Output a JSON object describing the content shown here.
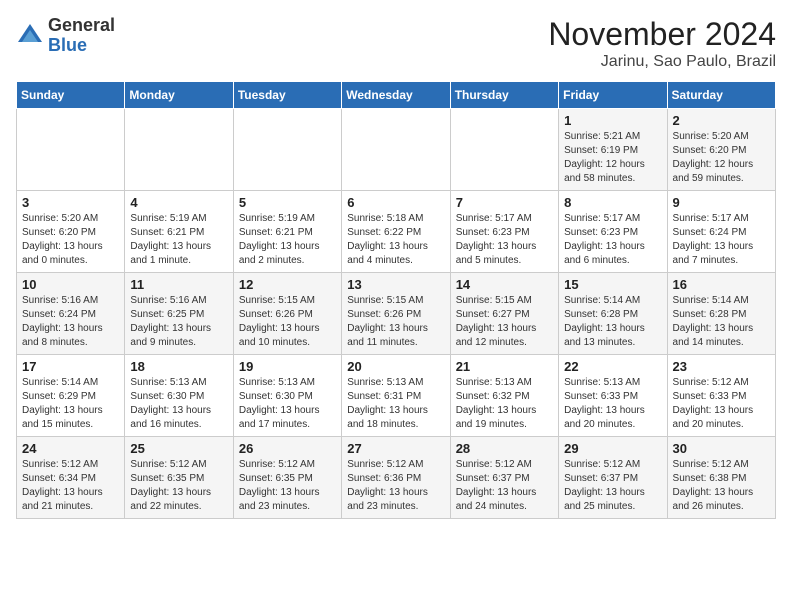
{
  "logo": {
    "general": "General",
    "blue": "Blue"
  },
  "title": "November 2024",
  "subtitle": "Jarinu, Sao Paulo, Brazil",
  "days_of_week": [
    "Sunday",
    "Monday",
    "Tuesday",
    "Wednesday",
    "Thursday",
    "Friday",
    "Saturday"
  ],
  "weeks": [
    [
      {
        "day": "",
        "sunrise": "",
        "sunset": "",
        "daylight": "",
        "empty": true
      },
      {
        "day": "",
        "sunrise": "",
        "sunset": "",
        "daylight": "",
        "empty": true
      },
      {
        "day": "",
        "sunrise": "",
        "sunset": "",
        "daylight": "",
        "empty": true
      },
      {
        "day": "",
        "sunrise": "",
        "sunset": "",
        "daylight": "",
        "empty": true
      },
      {
        "day": "",
        "sunrise": "",
        "sunset": "",
        "daylight": "",
        "empty": true
      },
      {
        "day": "1",
        "sunrise": "Sunrise: 5:21 AM",
        "sunset": "Sunset: 6:19 PM",
        "daylight": "Daylight: 12 hours and 58 minutes.",
        "empty": false
      },
      {
        "day": "2",
        "sunrise": "Sunrise: 5:20 AM",
        "sunset": "Sunset: 6:20 PM",
        "daylight": "Daylight: 12 hours and 59 minutes.",
        "empty": false
      }
    ],
    [
      {
        "day": "3",
        "sunrise": "Sunrise: 5:20 AM",
        "sunset": "Sunset: 6:20 PM",
        "daylight": "Daylight: 13 hours and 0 minutes.",
        "empty": false
      },
      {
        "day": "4",
        "sunrise": "Sunrise: 5:19 AM",
        "sunset": "Sunset: 6:21 PM",
        "daylight": "Daylight: 13 hours and 1 minute.",
        "empty": false
      },
      {
        "day": "5",
        "sunrise": "Sunrise: 5:19 AM",
        "sunset": "Sunset: 6:21 PM",
        "daylight": "Daylight: 13 hours and 2 minutes.",
        "empty": false
      },
      {
        "day": "6",
        "sunrise": "Sunrise: 5:18 AM",
        "sunset": "Sunset: 6:22 PM",
        "daylight": "Daylight: 13 hours and 4 minutes.",
        "empty": false
      },
      {
        "day": "7",
        "sunrise": "Sunrise: 5:17 AM",
        "sunset": "Sunset: 6:23 PM",
        "daylight": "Daylight: 13 hours and 5 minutes.",
        "empty": false
      },
      {
        "day": "8",
        "sunrise": "Sunrise: 5:17 AM",
        "sunset": "Sunset: 6:23 PM",
        "daylight": "Daylight: 13 hours and 6 minutes.",
        "empty": false
      },
      {
        "day": "9",
        "sunrise": "Sunrise: 5:17 AM",
        "sunset": "Sunset: 6:24 PM",
        "daylight": "Daylight: 13 hours and 7 minutes.",
        "empty": false
      }
    ],
    [
      {
        "day": "10",
        "sunrise": "Sunrise: 5:16 AM",
        "sunset": "Sunset: 6:24 PM",
        "daylight": "Daylight: 13 hours and 8 minutes.",
        "empty": false
      },
      {
        "day": "11",
        "sunrise": "Sunrise: 5:16 AM",
        "sunset": "Sunset: 6:25 PM",
        "daylight": "Daylight: 13 hours and 9 minutes.",
        "empty": false
      },
      {
        "day": "12",
        "sunrise": "Sunrise: 5:15 AM",
        "sunset": "Sunset: 6:26 PM",
        "daylight": "Daylight: 13 hours and 10 minutes.",
        "empty": false
      },
      {
        "day": "13",
        "sunrise": "Sunrise: 5:15 AM",
        "sunset": "Sunset: 6:26 PM",
        "daylight": "Daylight: 13 hours and 11 minutes.",
        "empty": false
      },
      {
        "day": "14",
        "sunrise": "Sunrise: 5:15 AM",
        "sunset": "Sunset: 6:27 PM",
        "daylight": "Daylight: 13 hours and 12 minutes.",
        "empty": false
      },
      {
        "day": "15",
        "sunrise": "Sunrise: 5:14 AM",
        "sunset": "Sunset: 6:28 PM",
        "daylight": "Daylight: 13 hours and 13 minutes.",
        "empty": false
      },
      {
        "day": "16",
        "sunrise": "Sunrise: 5:14 AM",
        "sunset": "Sunset: 6:28 PM",
        "daylight": "Daylight: 13 hours and 14 minutes.",
        "empty": false
      }
    ],
    [
      {
        "day": "17",
        "sunrise": "Sunrise: 5:14 AM",
        "sunset": "Sunset: 6:29 PM",
        "daylight": "Daylight: 13 hours and 15 minutes.",
        "empty": false
      },
      {
        "day": "18",
        "sunrise": "Sunrise: 5:13 AM",
        "sunset": "Sunset: 6:30 PM",
        "daylight": "Daylight: 13 hours and 16 minutes.",
        "empty": false
      },
      {
        "day": "19",
        "sunrise": "Sunrise: 5:13 AM",
        "sunset": "Sunset: 6:30 PM",
        "daylight": "Daylight: 13 hours and 17 minutes.",
        "empty": false
      },
      {
        "day": "20",
        "sunrise": "Sunrise: 5:13 AM",
        "sunset": "Sunset: 6:31 PM",
        "daylight": "Daylight: 13 hours and 18 minutes.",
        "empty": false
      },
      {
        "day": "21",
        "sunrise": "Sunrise: 5:13 AM",
        "sunset": "Sunset: 6:32 PM",
        "daylight": "Daylight: 13 hours and 19 minutes.",
        "empty": false
      },
      {
        "day": "22",
        "sunrise": "Sunrise: 5:13 AM",
        "sunset": "Sunset: 6:33 PM",
        "daylight": "Daylight: 13 hours and 20 minutes.",
        "empty": false
      },
      {
        "day": "23",
        "sunrise": "Sunrise: 5:12 AM",
        "sunset": "Sunset: 6:33 PM",
        "daylight": "Daylight: 13 hours and 20 minutes.",
        "empty": false
      }
    ],
    [
      {
        "day": "24",
        "sunrise": "Sunrise: 5:12 AM",
        "sunset": "Sunset: 6:34 PM",
        "daylight": "Daylight: 13 hours and 21 minutes.",
        "empty": false
      },
      {
        "day": "25",
        "sunrise": "Sunrise: 5:12 AM",
        "sunset": "Sunset: 6:35 PM",
        "daylight": "Daylight: 13 hours and 22 minutes.",
        "empty": false
      },
      {
        "day": "26",
        "sunrise": "Sunrise: 5:12 AM",
        "sunset": "Sunset: 6:35 PM",
        "daylight": "Daylight: 13 hours and 23 minutes.",
        "empty": false
      },
      {
        "day": "27",
        "sunrise": "Sunrise: 5:12 AM",
        "sunset": "Sunset: 6:36 PM",
        "daylight": "Daylight: 13 hours and 23 minutes.",
        "empty": false
      },
      {
        "day": "28",
        "sunrise": "Sunrise: 5:12 AM",
        "sunset": "Sunset: 6:37 PM",
        "daylight": "Daylight: 13 hours and 24 minutes.",
        "empty": false
      },
      {
        "day": "29",
        "sunrise": "Sunrise: 5:12 AM",
        "sunset": "Sunset: 6:37 PM",
        "daylight": "Daylight: 13 hours and 25 minutes.",
        "empty": false
      },
      {
        "day": "30",
        "sunrise": "Sunrise: 5:12 AM",
        "sunset": "Sunset: 6:38 PM",
        "daylight": "Daylight: 13 hours and 26 minutes.",
        "empty": false
      }
    ]
  ]
}
